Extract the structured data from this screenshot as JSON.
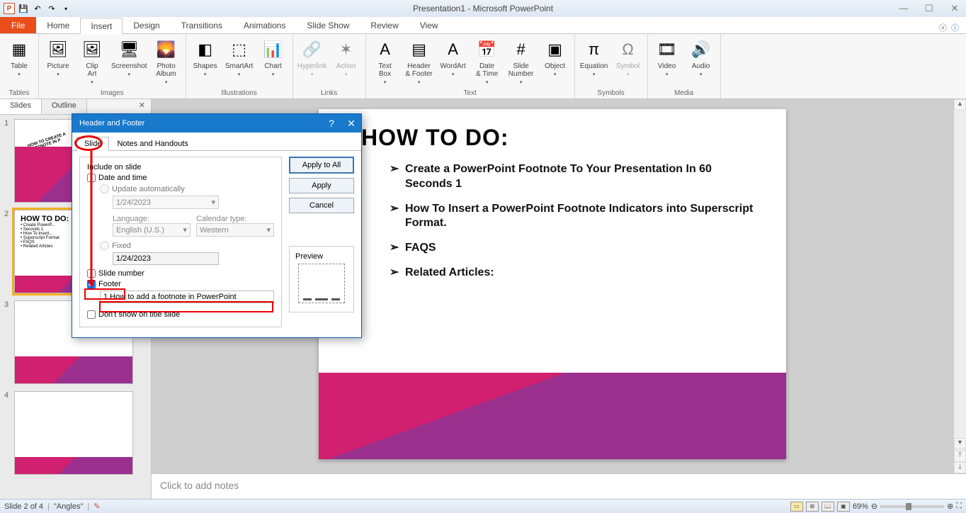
{
  "title": "Presentation1 - Microsoft PowerPoint",
  "menu": {
    "file": "File",
    "tabs": [
      "Home",
      "Insert",
      "Design",
      "Transitions",
      "Animations",
      "Slide Show",
      "Review",
      "View"
    ],
    "active": "Insert"
  },
  "ribbon": {
    "groups": [
      {
        "label": "Tables",
        "items": [
          {
            "l": "Table",
            "g": "▦"
          }
        ]
      },
      {
        "label": "Images",
        "items": [
          {
            "l": "Picture",
            "g": "🖼"
          },
          {
            "l": "Clip\nArt",
            "g": "🖼"
          },
          {
            "l": "Screenshot",
            "g": "🖥"
          },
          {
            "l": "Photo\nAlbum",
            "g": "🌄"
          }
        ]
      },
      {
        "label": "Illustrations",
        "items": [
          {
            "l": "Shapes",
            "g": "◧"
          },
          {
            "l": "SmartArt",
            "g": "⬚"
          },
          {
            "l": "Chart",
            "g": "📊"
          }
        ]
      },
      {
        "label": "Links",
        "items": [
          {
            "l": "Hyperlink",
            "g": "🔗",
            "d": true
          },
          {
            "l": "Action",
            "g": "✶",
            "d": true
          }
        ]
      },
      {
        "label": "Text",
        "items": [
          {
            "l": "Text\nBox",
            "g": "A"
          },
          {
            "l": "Header\n& Footer",
            "g": "▤"
          },
          {
            "l": "WordArt",
            "g": "A"
          },
          {
            "l": "Date\n& Time",
            "g": "📅"
          },
          {
            "l": "Slide\nNumber",
            "g": "#"
          },
          {
            "l": "Object",
            "g": "▣"
          }
        ]
      },
      {
        "label": "Symbols",
        "items": [
          {
            "l": "Equation",
            "g": "π"
          },
          {
            "l": "Symbol",
            "g": "Ω",
            "d": true
          }
        ]
      },
      {
        "label": "Media",
        "items": [
          {
            "l": "Video",
            "g": "🎞"
          },
          {
            "l": "Audio",
            "g": "🔊"
          }
        ]
      }
    ]
  },
  "leftTabs": {
    "slides": "Slides",
    "outline": "Outline"
  },
  "slide": {
    "heading": "HOW TO DO:",
    "bullets": [
      "Create a PowerPoint Footnote To Your Presentation In 60 Seconds  1",
      "How To Insert a PowerPoint Footnote Indicators into Superscript Format.",
      "FAQS",
      "Related Articles:"
    ]
  },
  "notes": "Click to add notes",
  "status": {
    "slide": "Slide 2 of 4",
    "theme": "\"Angles\"",
    "zoom": "69%"
  },
  "dialog": {
    "title": "Header and Footer",
    "tabs": {
      "slide": "Slide",
      "notes": "Notes and Handouts"
    },
    "include": "Include on slide",
    "dateTime": "Date and time",
    "updateAuto": "Update automatically",
    "date1": "1/24/2023",
    "langLabel": "Language:",
    "lang": "English (U.S.)",
    "calLabel": "Calendar type:",
    "cal": "Western",
    "fixed": "Fixed",
    "date2": "1/24/2023",
    "slideNum": "Slide number",
    "footer": "Footer",
    "footerText": "1 How to add a footnote in PowerPoint",
    "dontShow": "Don't show on title slide",
    "applyAll": "Apply to All",
    "apply": "Apply",
    "cancel": "Cancel",
    "preview": "Preview"
  }
}
